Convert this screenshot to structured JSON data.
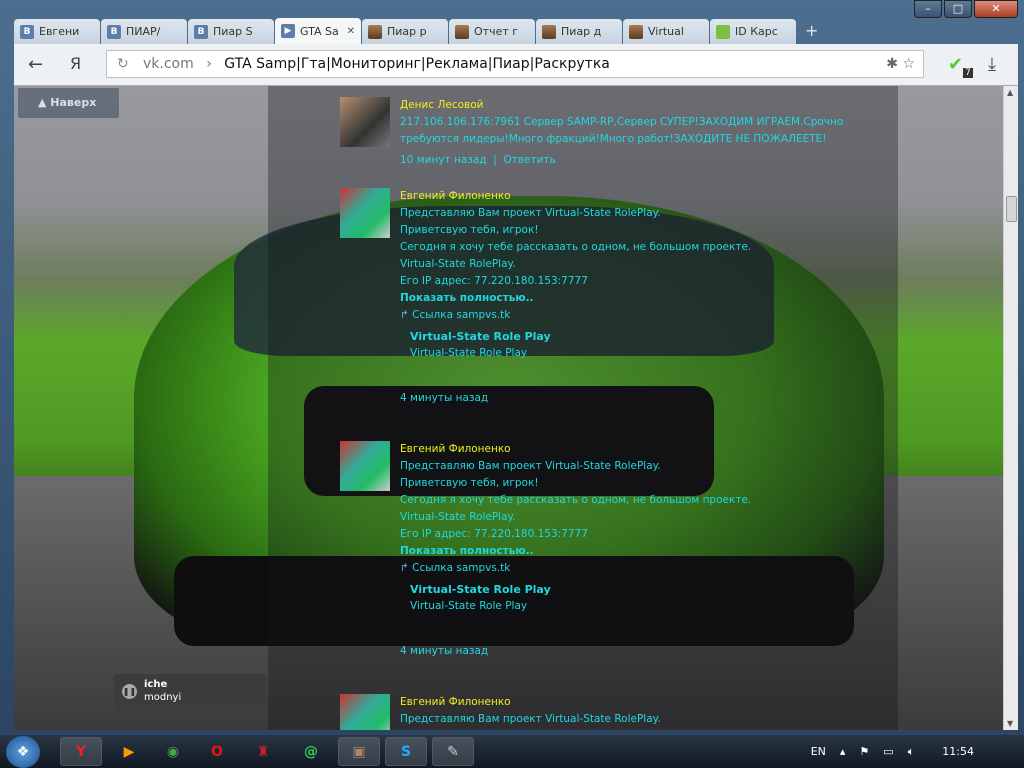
{
  "tabs": [
    {
      "label": "Евгени",
      "icon": "vk-icon"
    },
    {
      "label": "ПИАР/",
      "icon": "vk-icon"
    },
    {
      "label": "Пиар S",
      "icon": "vk-icon"
    },
    {
      "label": "GTA Sa",
      "icon": "vk-app-icon",
      "active": true
    },
    {
      "label": "Пиар р",
      "icon": "avatar-icon"
    },
    {
      "label": "Отчет г",
      "icon": "avatar-icon"
    },
    {
      "label": "Пиар д",
      "icon": "avatar-icon"
    },
    {
      "label": "Virtual",
      "icon": "avatar-icon"
    },
    {
      "label": "ID Карс",
      "icon": "chat-icon"
    }
  ],
  "toolbar": {
    "yandex": "Я",
    "host": "vk.com",
    "sep": "›",
    "title": "GTA Samp|Гта|Мониторинг|Реклама|Пиар|Раскрутка",
    "badge": "7"
  },
  "page": {
    "up_label": "Наверх"
  },
  "posts": [
    {
      "name": "Денис Лесовой",
      "lines": [
        "217.106.106.176:7961 Сервер SAMP-RP,Сервер СУПЕР!ЗАХОДИМ ИГРАЕМ.Срочно требуются лидеры!Много фракций!Много работ!ЗАХОДИТЕ НЕ ПОЖАЛЕЕТЕ!"
      ],
      "time": "10 минут назад",
      "reply": "Ответить"
    },
    {
      "name": "Евгений Филоненко",
      "lines": [
        "Представляю Вам проект Virtual-State RolePlay.",
        "Приветсвую тебя, игрок!",
        "Сегодня я хочу тебе рассказать о одном, не большом проекте.",
        "Virtual-State RolePlay.",
        "Его IP адрес: 77.220.180.153:7777"
      ],
      "more": "Показать полностью..",
      "link": "Ссылка sampvs.tk",
      "link_title": "Virtual-State Role Play",
      "link_desc": "Virtual-State Role Play",
      "time": "4 минуты назад"
    },
    {
      "name": "Евгений Филоненко",
      "lines": [
        "Представляю Вам проект Virtual-State RolePlay.",
        "Приветсвую тебя, игрок!",
        "Сегодня я хочу тебе рассказать о одном, не большом проекте.",
        "Virtual-State RolePlay.",
        "Его IP адрес: 77.220.180.153:7777"
      ],
      "more": "Показать полностью..",
      "link": "Ссылка sampvs.tk",
      "link_title": "Virtual-State Role Play",
      "link_desc": "Virtual-State Role Play",
      "time": "4 минуты назад"
    },
    {
      "name": "Евгений Филоненко",
      "lines": [
        "Представляю Вам проект Virtual-State RolePlay."
      ]
    }
  ],
  "player": {
    "title": "iche",
    "artist": "modnyi"
  },
  "taskbar": {
    "lang": "EN",
    "time": "11:54"
  }
}
